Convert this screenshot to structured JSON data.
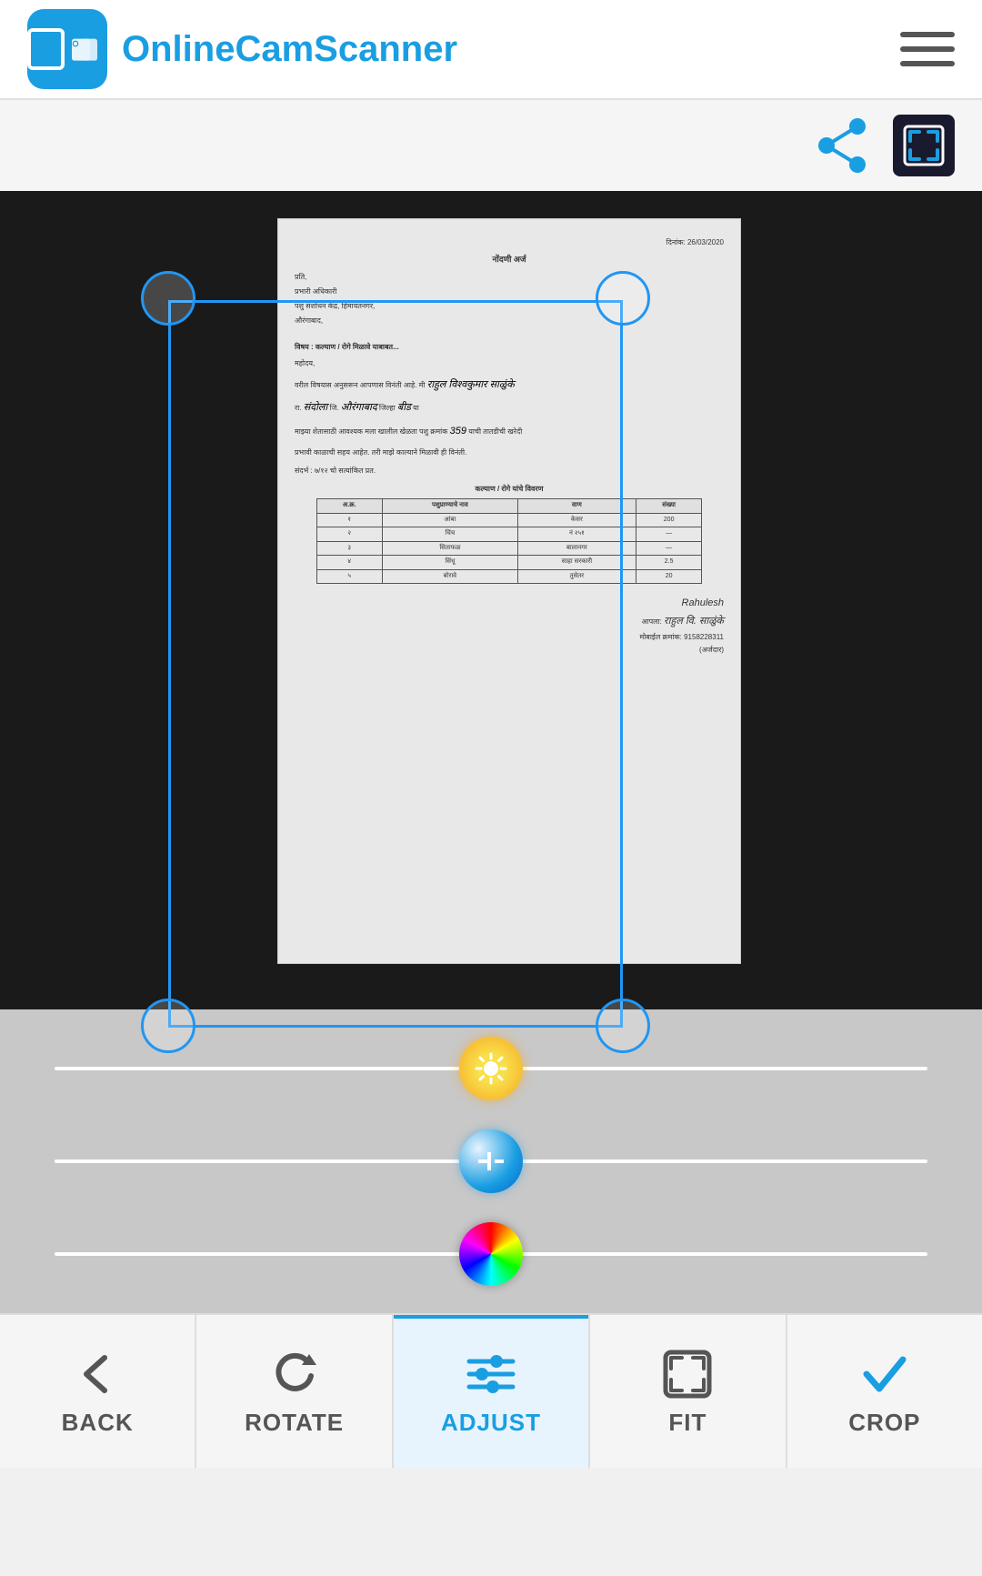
{
  "header": {
    "app_name": "OnlineCamScanner",
    "logo_alt": "OnlineCamScanner Logo"
  },
  "toolbar": {
    "share_label": "share",
    "fullscreen_label": "fullscreen"
  },
  "document": {
    "date": "दिनांक: 26/03/2020",
    "title": "नोंदणी अर्ज",
    "to": "प्रति,",
    "address1": "प्रभारी अधिकारी",
    "address2": "पशु संशोधन केंद्र, हिमायतनगर,",
    "address3": "औरंगाबाद,",
    "subject": "विषय : कल्याण / रोगे मिळावे याबाबत...",
    "body1": "महोदय,",
    "body2": "वरील विषयास अनुसरून आपणास विनंती आहे. मी राहुल विश्वकुमार साळुंके",
    "body3": "रा. संदोला जि. औरंगाबाद जिल्हा बीड या",
    "body4": "माझ्या शेतासाठी आवश्यक मला खालील खेळता पशु क्रमांक 359 याची तातडीची खरेदी",
    "body5": "प्रभावी काळाची सहय आहेत. तरी माझे काल्याने मिळावी ही विनंती.",
    "ref": "संदर्भ : ७/१२ चो सत्यांकित प्रत.",
    "table_title": "कल्याण / रोगे यांचे विवरण",
    "table_headers": [
      "अ.क्र.",
      "पशुप्राण्याचे नाव",
      "वाण",
      "संख्या"
    ],
    "table_rows": [
      [
        "१",
        "आंबा",
        "केसर",
        "200"
      ],
      [
        "२",
        "चिंच",
        "नं २५१",
        "—"
      ],
      [
        "३",
        "सिताफळ",
        "बालानगर",
        "—"
      ],
      [
        "४",
        "सिंधू",
        "साहा सरकारी",
        "2.5"
      ],
      [
        "५",
        "बोरावे",
        "तुसेतर",
        "20"
      ]
    ],
    "signature_label": "आपला",
    "signature_name": "राहुल वि. साळुंके",
    "mobile_label": "मोबाईल क्रमांक: 9158228311",
    "stamp": "(अर्जदार)"
  },
  "sliders": {
    "brightness_icon": "sun-icon",
    "exposure_icon": "exposure-icon",
    "color_icon": "color-wheel-icon"
  },
  "bottom_nav": {
    "items": [
      {
        "id": "back",
        "label": "BACK",
        "icon": "back-arrow-icon",
        "active": false
      },
      {
        "id": "rotate",
        "label": "ROTATE",
        "icon": "rotate-icon",
        "active": false
      },
      {
        "id": "adjust",
        "label": "ADJUST",
        "icon": "adjust-icon",
        "active": true
      },
      {
        "id": "fit",
        "label": "FIT",
        "icon": "fit-icon",
        "active": false
      },
      {
        "id": "crop",
        "label": "CROP",
        "icon": "crop-checkmark-icon",
        "active": false
      }
    ]
  }
}
